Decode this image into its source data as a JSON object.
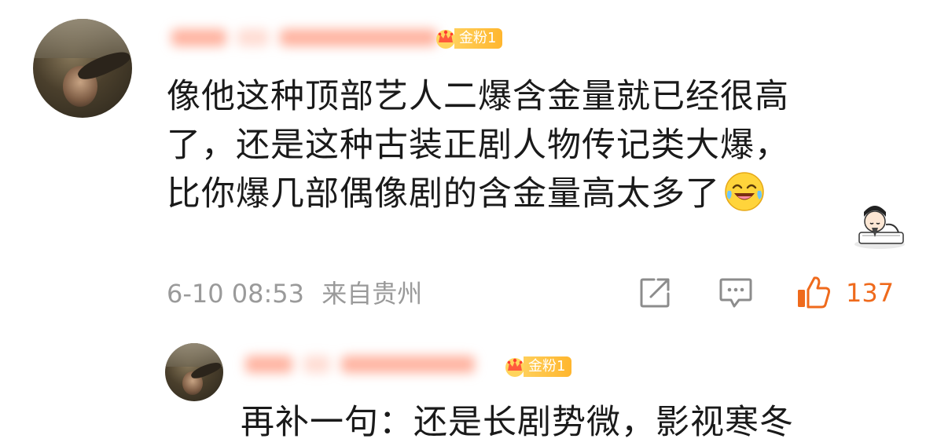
{
  "comment": {
    "badge": "金粉1",
    "text_lines": [
      "像他这种顶部艺人二爆含金量就已经很高",
      "了，还是这种古装正剧人物传记类大爆，",
      "比你爆几部偶像剧的含金量高太多了"
    ],
    "emoji": "laughing-tears-emoji",
    "sticker": "cartoon-scholar-sticker",
    "time": "6-10 08:53",
    "location": "来自贵州",
    "likes": "137",
    "icons": {
      "share": "share-icon",
      "comment": "comment-icon",
      "like": "thumbs-up-icon"
    },
    "colors": {
      "like_accent": "#ef6a1c",
      "badge_gold": "#ffb62e",
      "meta_gray": "#9a9a9a"
    }
  },
  "reply": {
    "badge": "金粉1",
    "text": "再补一句：还是长剧势微，影视寒冬"
  }
}
